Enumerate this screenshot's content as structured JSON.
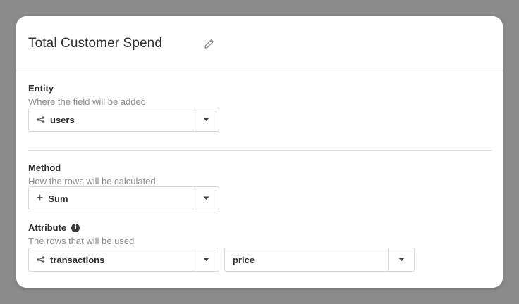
{
  "header": {
    "title": "Total Customer Spend"
  },
  "entity": {
    "label": "Entity",
    "description": "Where the field will be added",
    "value": "users"
  },
  "method": {
    "label": "Method",
    "description": "How the rows will be calculated",
    "value": "Sum"
  },
  "attribute": {
    "label": "Attribute",
    "description": "The rows that will be used",
    "entity_value": "transactions",
    "field_value": "price"
  },
  "icons": {
    "edit": "pencil-icon",
    "relation": "relation-icon",
    "caret": "caret-down-icon",
    "info": "info-icon",
    "plus": "plus-icon"
  },
  "colors": {
    "overlay": "#8b8b8b",
    "text": "#2c2c2e",
    "muted": "#8a8a8e",
    "border": "#d7d7d9"
  }
}
